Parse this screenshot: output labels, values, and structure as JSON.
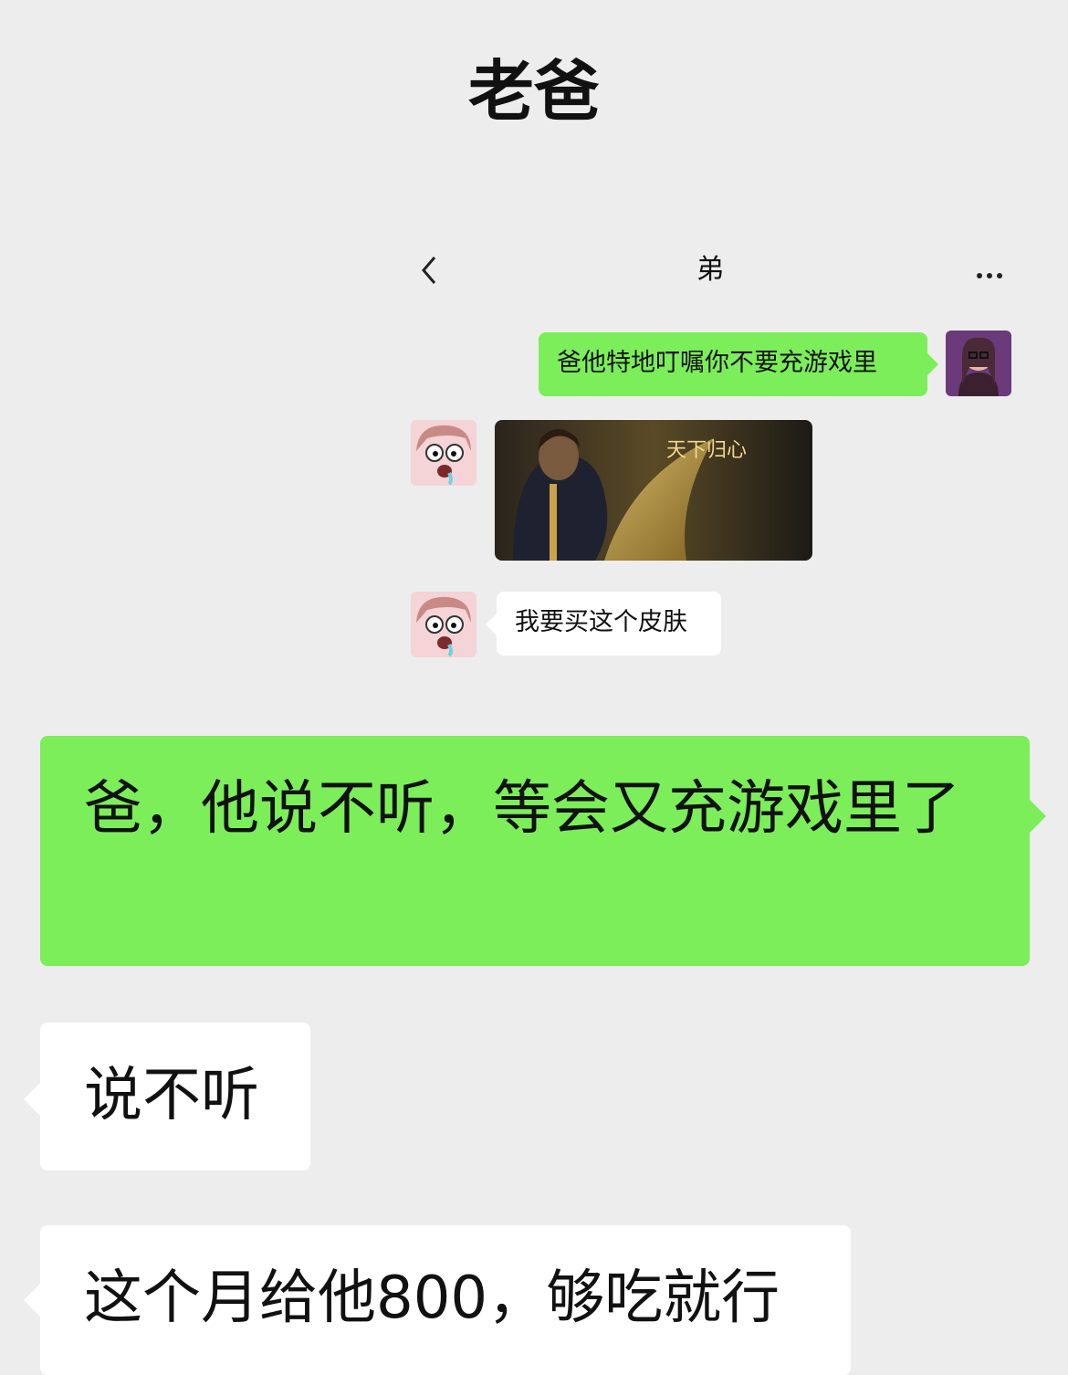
{
  "header": {
    "title": "老爸"
  },
  "inner_chat": {
    "title": "弟",
    "messages": [
      {
        "from": "me",
        "text": "爸他特地叮嘱你不要充游戏里"
      },
      {
        "from": "brother",
        "type": "image",
        "image_text": "天下归心"
      },
      {
        "from": "brother",
        "text": "我要买这个皮肤"
      }
    ]
  },
  "messages": [
    {
      "from": "me",
      "text": "爸，他说不听，等会又充游戏里了"
    },
    {
      "from": "dad",
      "text": "说不听"
    },
    {
      "from": "dad",
      "text": "这个月给他800，够吃就行"
    }
  ],
  "colors": {
    "background": "#ededed",
    "sent_bubble": "#7cee5a",
    "received_bubble": "#ffffff"
  }
}
